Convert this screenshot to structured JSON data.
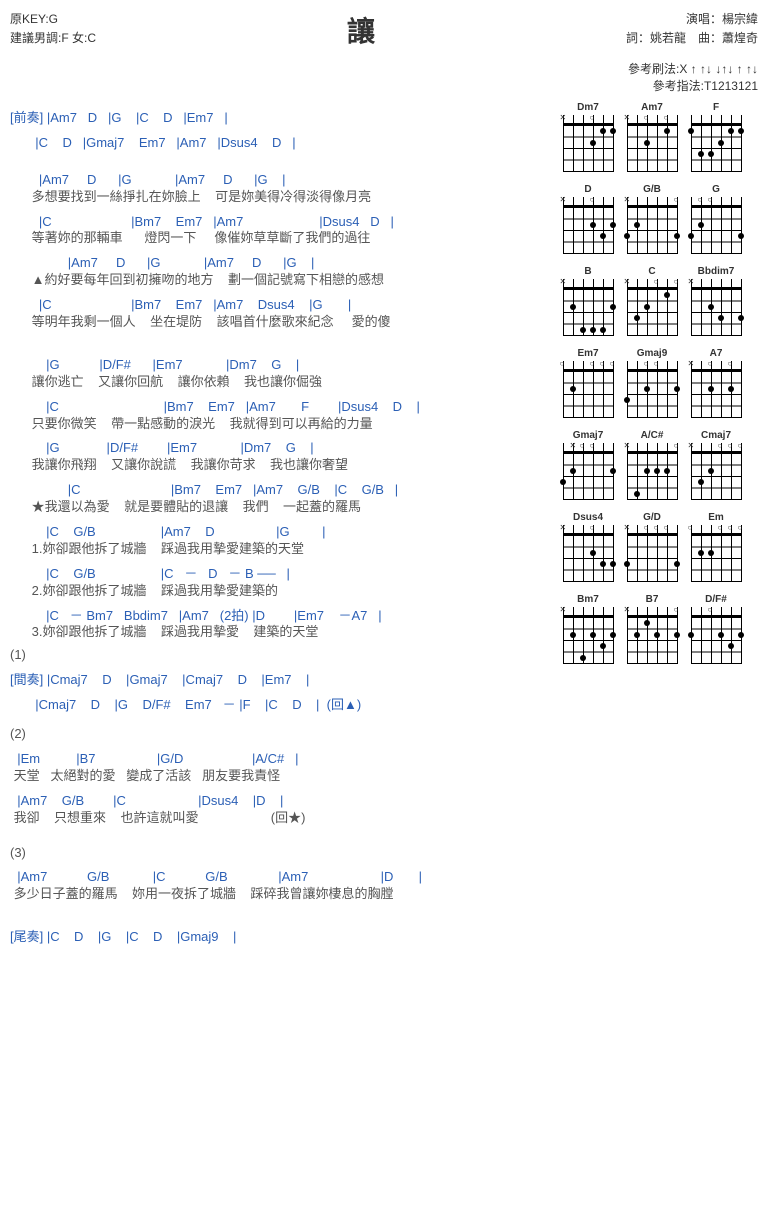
{
  "header": {
    "original_key": "原KEY:G",
    "suggested": "建議男調:F 女:C",
    "title": "讓",
    "performer": "演唱：楊宗緯",
    "lyricist": "詞：姚若龍　曲：蕭煌奇"
  },
  "patterns": {
    "strum": "參考刷法:X ↑ ↑↓  ↓↑↓ ↑ ↑↓",
    "finger": "參考指法:T1213121"
  },
  "lines": [
    {
      "type": "chord",
      "text": "[前奏] |Am7   D   |G    |C    D   |Em7   |"
    },
    {
      "type": "chord",
      "text": "       |C    D   |Gmaj7    Em7   |Am7   |Dsus4    D   |"
    },
    {
      "type": "spacer"
    },
    {
      "type": "chord",
      "text": "        |Am7     D      |G            |Am7     D      |G    |"
    },
    {
      "type": "lyric",
      "text": "      多想要找到一絲掙扎在妳臉上    可是妳美得冷得淡得像月亮"
    },
    {
      "type": "chord",
      "text": "        |C                      |Bm7    Em7   |Am7                     |Dsus4   D   |"
    },
    {
      "type": "lyric",
      "text": "      等著妳的那輛車      燈閃一下     像催妳草草斷了我們的過往"
    },
    {
      "type": "chord",
      "text": "                |Am7     D      |G            |Am7     D      |G    |"
    },
    {
      "type": "lyric",
      "text": "      ▲約好要每年回到初擁吻的地方    劃一個記號寫下相戀的感想"
    },
    {
      "type": "chord",
      "text": "        |C                      |Bm7    Em7   |Am7    Dsus4    |G       |"
    },
    {
      "type": "lyric",
      "text": "      等明年我剩一個人    坐在堤防    該唱首什麼歌來紀念     愛的傻"
    },
    {
      "type": "spacer"
    },
    {
      "type": "chord",
      "text": "          |G           |D/F#      |Em7            |Dm7    G    |"
    },
    {
      "type": "lyric",
      "text": "      讓你逃亡    又讓你回航    讓你依賴    我也讓你倔強"
    },
    {
      "type": "chord",
      "text": "          |C                             |Bm7    Em7   |Am7       F        |Dsus4    D    |"
    },
    {
      "type": "lyric",
      "text": "      只要你微笑    帶一點感動的淚光    我就得到可以再給的力量"
    },
    {
      "type": "chord",
      "text": "          |G             |D/F#        |Em7            |Dm7    G    |"
    },
    {
      "type": "lyric",
      "text": "      我讓你飛翔    又讓你說謊    我讓你苛求    我也讓你奢望"
    },
    {
      "type": "chord",
      "text": "                |C                         |Bm7    Em7   |Am7    G/B    |C    G/B   |"
    },
    {
      "type": "lyric",
      "text": "      ★我還以為愛    就是要體貼的退讓    我們    一起蓋的羅馬"
    },
    {
      "type": "chord",
      "text": "          |C    G/B                  |Am7    D                 |G         |"
    },
    {
      "type": "lyric",
      "text": "      1.妳卻跟他拆了城牆    踩過我用摯愛建築的天堂"
    },
    {
      "type": "chord",
      "text": "          |C    G/B                  |C   －   D   － B ──   |"
    },
    {
      "type": "lyric",
      "text": "      2.妳卻跟他拆了城牆    踩過我用摯愛建築的"
    },
    {
      "type": "chord",
      "text": "          |C   － Bm7   Bbdim7   |Am7   (2拍) |D        |Em7    －A7   |"
    },
    {
      "type": "lyric",
      "text": "      3.妳卻跟他拆了城牆    踩過我用摯愛    建築的天堂"
    },
    {
      "type": "lyric",
      "text": "(1)"
    },
    {
      "type": "chord",
      "text": "[間奏] |Cmaj7    D    |Gmaj7    |Cmaj7    D    |Em7    |"
    },
    {
      "type": "chord",
      "text": "       |Cmaj7    D    |G    D/F#    Em7   － |F    |C    D    |  (回▲)"
    },
    {
      "type": "spacer"
    },
    {
      "type": "lyric",
      "text": "(2)"
    },
    {
      "type": "chord",
      "text": "  |Em          |B7                 |G/D                   |A/C#   |"
    },
    {
      "type": "lyric",
      "text": " 天堂   太絕對的愛   變成了活該   朋友要我責怪"
    },
    {
      "type": "chord",
      "text": "  |Am7    G/B        |C                    |Dsus4    |D    |"
    },
    {
      "type": "lyric",
      "text": " 我卻    只想重來    也許這就叫愛                    (回★)"
    },
    {
      "type": "spacer"
    },
    {
      "type": "lyric",
      "text": "(3)"
    },
    {
      "type": "chord",
      "text": "  |Am7           G/B            |C           G/B              |Am7                    |D       |"
    },
    {
      "type": "lyric",
      "text": " 多少日子蓋的羅馬    妳用一夜拆了城牆    踩碎我曾讓妳棲息的胸膛"
    },
    {
      "type": "spacer"
    },
    {
      "type": "chord",
      "text": "[尾奏] |C    D    |G    |C    D    |Gmaj9    |"
    }
  ],
  "chord_diagrams": [
    {
      "name": "Dm7",
      "dots": [
        {
          "s": 1,
          "f": 1
        },
        {
          "s": 2,
          "f": 1
        },
        {
          "s": 3,
          "f": 2
        }
      ],
      "marks": "X  O   "
    },
    {
      "name": "Am7",
      "dots": [
        {
          "s": 2,
          "f": 1
        },
        {
          "s": 4,
          "f": 2
        }
      ],
      "marks": "X O O O"
    },
    {
      "name": "F",
      "dots": [
        {
          "s": 1,
          "f": 1
        },
        {
          "s": 2,
          "f": 1
        },
        {
          "s": 6,
          "f": 1
        },
        {
          "s": 3,
          "f": 2
        },
        {
          "s": 4,
          "f": 3
        },
        {
          "s": 5,
          "f": 3
        }
      ],
      "marks": ""
    },
    {
      "name": "D",
      "dots": [
        {
          "s": 1,
          "f": 2
        },
        {
          "s": 3,
          "f": 2
        },
        {
          "s": 2,
          "f": 3
        }
      ],
      "marks": "X  O   "
    },
    {
      "name": "G/B",
      "dots": [
        {
          "s": 5,
          "f": 2
        },
        {
          "s": 1,
          "f": 3
        },
        {
          "s": 6,
          "f": 3
        }
      ],
      "marks": "X    O "
    },
    {
      "name": "G",
      "dots": [
        {
          "s": 5,
          "f": 2
        },
        {
          "s": 1,
          "f": 3
        },
        {
          "s": 6,
          "f": 3
        }
      ],
      "marks": " OO   "
    },
    {
      "name": "B",
      "dots": [
        {
          "s": 1,
          "f": 2
        },
        {
          "s": 5,
          "f": 2
        },
        {
          "s": 2,
          "f": 4
        },
        {
          "s": 3,
          "f": 4
        },
        {
          "s": 4,
          "f": 4
        }
      ],
      "marks": "X     "
    },
    {
      "name": "C",
      "dots": [
        {
          "s": 2,
          "f": 1
        },
        {
          "s": 4,
          "f": 2
        },
        {
          "s": 5,
          "f": 3
        }
      ],
      "marks": "X  O O"
    },
    {
      "name": "Bbdim7",
      "dots": [
        {
          "s": 4,
          "f": 2
        },
        {
          "s": 1,
          "f": 3
        },
        {
          "s": 3,
          "f": 3
        }
      ],
      "marks": "X     "
    },
    {
      "name": "Em7",
      "dots": [
        {
          "s": 5,
          "f": 2
        }
      ],
      "marks": "O  OOO"
    },
    {
      "name": "Gmaj9",
      "dots": [
        {
          "s": 1,
          "f": 2
        },
        {
          "s": 4,
          "f": 2
        },
        {
          "s": 6,
          "f": 3
        }
      ],
      "marks": "  OO  "
    },
    {
      "name": "A7",
      "dots": [
        {
          "s": 2,
          "f": 2
        },
        {
          "s": 4,
          "f": 2
        }
      ],
      "marks": "X O O "
    },
    {
      "name": "Gmaj7",
      "dots": [
        {
          "s": 1,
          "f": 2
        },
        {
          "s": 5,
          "f": 2
        },
        {
          "s": 6,
          "f": 3
        }
      ],
      "marks": " XOO  "
    },
    {
      "name": "A/C#",
      "dots": [
        {
          "s": 3,
          "f": 2
        },
        {
          "s": 4,
          "f": 2
        },
        {
          "s": 2,
          "f": 2
        },
        {
          "s": 5,
          "f": 4
        }
      ],
      "marks": "X    O"
    },
    {
      "name": "Cmaj7",
      "dots": [
        {
          "s": 4,
          "f": 2
        },
        {
          "s": 5,
          "f": 3
        }
      ],
      "marks": "X  OOO"
    },
    {
      "name": "Dsus4",
      "dots": [
        {
          "s": 3,
          "f": 2
        },
        {
          "s": 1,
          "f": 3
        },
        {
          "s": 2,
          "f": 3
        }
      ],
      "marks": "X  O  "
    },
    {
      "name": "G/D",
      "dots": [
        {
          "s": 1,
          "f": 3
        },
        {
          "s": 6,
          "f": 3
        }
      ],
      "marks": "X OOO "
    },
    {
      "name": "Em",
      "dots": [
        {
          "s": 4,
          "f": 2
        },
        {
          "s": 5,
          "f": 2
        }
      ],
      "marks": "O  OOO"
    },
    {
      "name": "Bm7",
      "dots": [
        {
          "s": 1,
          "f": 2
        },
        {
          "s": 5,
          "f": 2
        },
        {
          "s": 3,
          "f": 2
        },
        {
          "s": 2,
          "f": 3
        },
        {
          "s": 4,
          "f": 4
        }
      ],
      "marks": "X     ",
      "fret": 2
    },
    {
      "name": "B7",
      "dots": [
        {
          "s": 4,
          "f": 1
        },
        {
          "s": 1,
          "f": 2
        },
        {
          "s": 3,
          "f": 2
        },
        {
          "s": 5,
          "f": 2
        }
      ],
      "marks": "X    O"
    },
    {
      "name": "D/F#",
      "dots": [
        {
          "s": 1,
          "f": 2
        },
        {
          "s": 3,
          "f": 2
        },
        {
          "s": 6,
          "f": 2
        },
        {
          "s": 2,
          "f": 3
        }
      ],
      "marks": "  O   "
    }
  ]
}
